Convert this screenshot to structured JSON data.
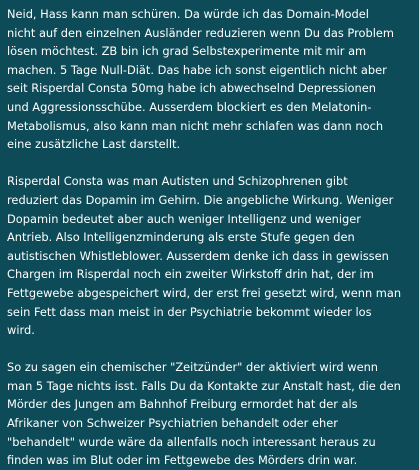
{
  "post": {
    "paragraphs": [
      "Neid, Hass kann man schüren. Da würde ich das Domain-Model\nnicht auf den einzelnen Ausländer reduzieren wenn Du das Problem\nlösen möchtest. ZB bin ich grad Selbstexperimente mit mir am\nmachen. 5 Tage Null-Diät. Das habe ich sonst eigentlich nicht aber\nseit Risperdal Consta 50mg habe ich abwechselnd Depressionen\nund Aggressionsschübe. Ausserdem blockiert es den Melatonin-\nMetabolismus, also kann man nicht mehr schlafen was dann noch\neine zusätzliche Last darstellt.",
      "Risperdal Consta was man Autisten und Schizophrenen gibt\nreduziert das Dopamin im Gehirn. Die angebliche Wirkung. Weniger\nDopamin bedeutet aber auch weniger Intelligenz und weniger\nAntrieb. Also Intelligenzminderung als erste Stufe gegen den\nautistischen Whistleblower. Ausserdem denke ich dass in gewissen\nChargen im Risperdal noch ein zweiter Wirkstoff drin hat, der im\nFettgewebe abgespeichert wird, der erst frei gesetzt wird, wenn man\nsein Fett dass man meist in der Psychiatrie bekommt wieder los\nwird.",
      "So zu sagen ein chemischer \"Zeitzünder\" der aktiviert wird wenn\nman 5 Tage nichts isst. Falls Du da Kontakte zur Anstalt hast, die den\nMörder des Jungen am Bahnhof Freiburg ermordet hat der als\nAfrikaner von Schweizer Psychiatrien behandelt oder eher\n\"behandelt\" wurde wäre da allenfalls noch interessant heraus zu\nfinden was im Blut oder im Fettgewebe des Mörders drin war."
    ]
  }
}
